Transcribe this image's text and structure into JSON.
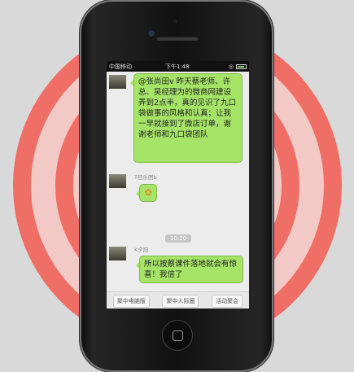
{
  "status_bar": {
    "carrier": "中国移动",
    "time": "下午1:48"
  },
  "messages": [
    {
      "sender": "",
      "text": "@张尚田v 昨天蔡老师、许总、吴经理为的微商网建设弄到2点半，真的见识了九口袋做事的风格和认真；让我一早就接到了微店订单，谢谢老师和九口袋团队"
    },
    {
      "sender": "T狂乐团b",
      "text": ""
    },
    {
      "sender": "K夕阳",
      "text": "所以按蔡课件落地就会有惊喜！我信了"
    }
  ],
  "timestamp": "10:20",
  "toolbar": {
    "buttons": [
      "聚中电脑版",
      "聚中人际圈",
      "活动聚会"
    ]
  },
  "colors": {
    "ring": "#ef6e66",
    "bubble": "#a6e468"
  }
}
